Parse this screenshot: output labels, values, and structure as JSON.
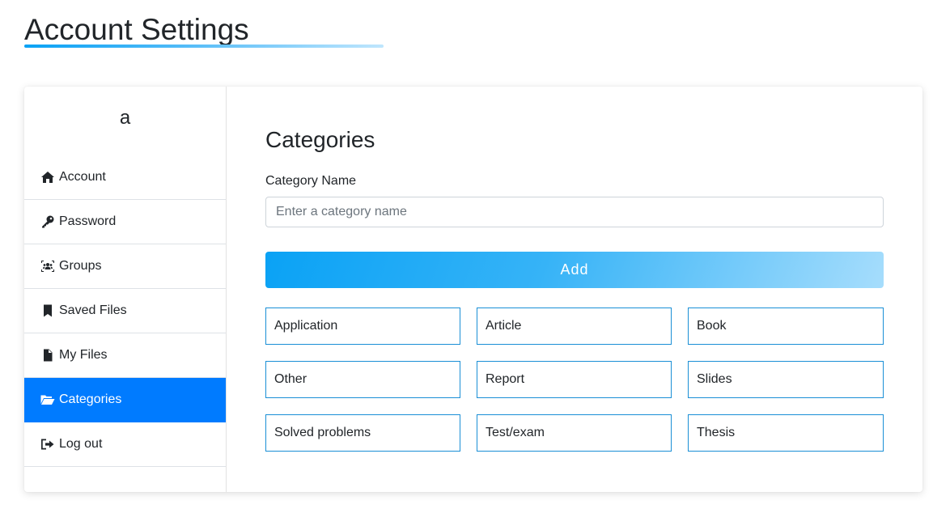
{
  "page": {
    "title": "Account Settings"
  },
  "sidebar": {
    "avatar_text": "a",
    "items": [
      {
        "label": "Account",
        "icon": "home-icon",
        "active": false
      },
      {
        "label": "Password",
        "icon": "key-icon",
        "active": false
      },
      {
        "label": "Groups",
        "icon": "users-icon",
        "active": false
      },
      {
        "label": "Saved Files",
        "icon": "bookmark-icon",
        "active": false
      },
      {
        "label": "My Files",
        "icon": "file-icon",
        "active": false
      },
      {
        "label": "Categories",
        "icon": "folder-open-icon",
        "active": true
      },
      {
        "label": "Log out",
        "icon": "sign-out-icon",
        "active": false
      }
    ]
  },
  "main": {
    "heading": "Categories",
    "field_label": "Category Name",
    "input_placeholder": "Enter a category name",
    "input_value": "",
    "add_label": "Add",
    "categories": [
      "Application",
      "Article",
      "Book",
      "Other",
      "Report",
      "Slides",
      "Solved problems",
      "Test/exam",
      "Thesis"
    ]
  },
  "colors": {
    "accent": "#007bff",
    "gradient_start": "#0aa2f5",
    "gradient_end": "#a6ddfc",
    "category_border": "#1a8fd6"
  }
}
